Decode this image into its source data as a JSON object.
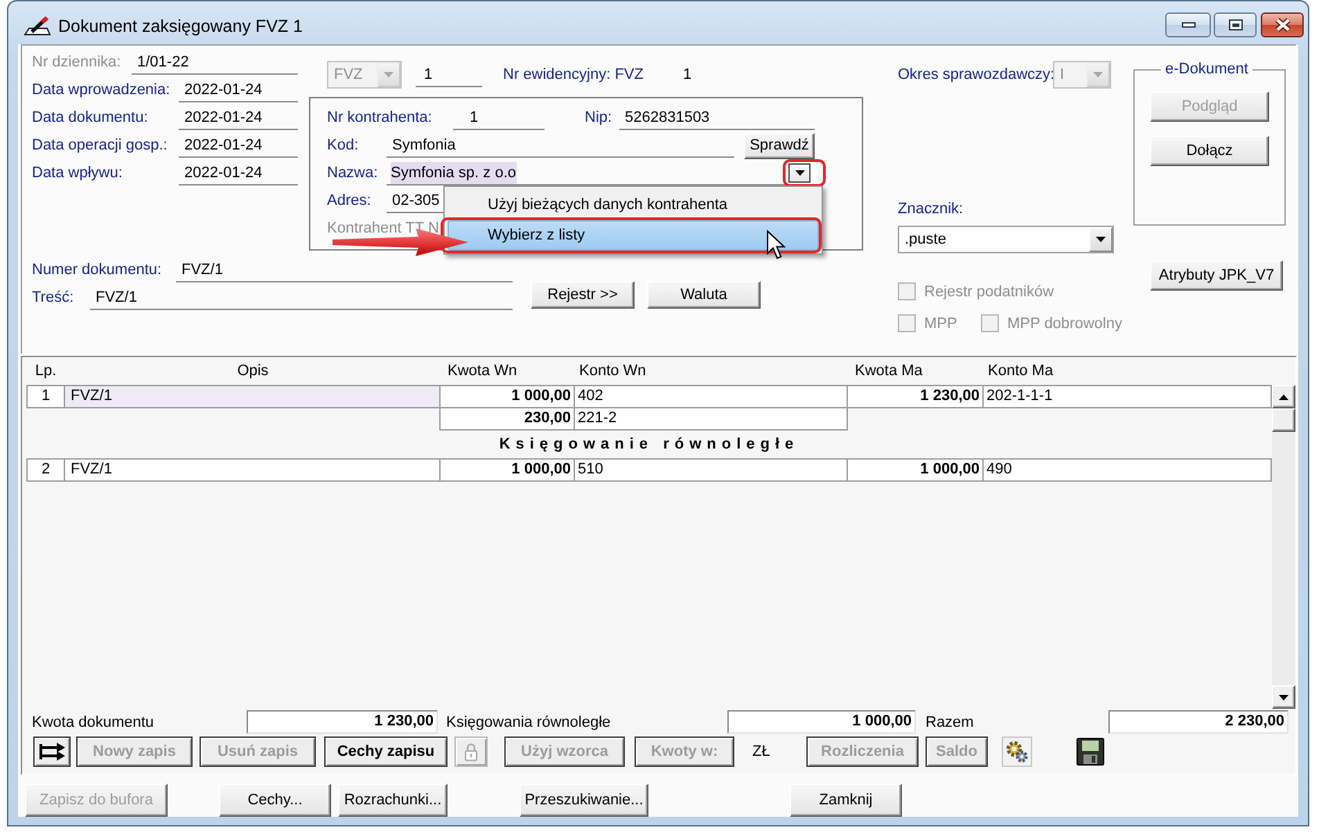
{
  "window": {
    "title": "Dokument zaksięgowany FVZ 1"
  },
  "header": {
    "journal_number": {
      "label": "Nr dziennika:",
      "value": "1/01-22",
      "disabled": true
    },
    "dates": [
      {
        "label": "Data wprowadzenia:",
        "value": "2022-01-24"
      },
      {
        "label": "Data dokumentu:",
        "value": "2022-01-24"
      },
      {
        "label": "Data operacji gosp.:",
        "value": "2022-01-24"
      },
      {
        "label": "Data wpływu:",
        "value": "2022-01-24"
      }
    ],
    "register": {
      "value": "FVZ",
      "disabled": true
    },
    "register_number": "1",
    "record_number": {
      "label": "Nr ewidencyjny: FVZ",
      "value": "1"
    },
    "contractor": {
      "number": {
        "label": "Nr kontrahenta:",
        "value": "1"
      },
      "nip": {
        "label": "Nip:",
        "value": "5262831503"
      },
      "code": {
        "label": "Kod:",
        "value": "Symfonia"
      },
      "check_button": "Sprawdź",
      "name": {
        "label": "Nazwa:",
        "value": "Symfonia sp. z o.o",
        "text_selected": true,
        "dropdown_highlighted": true
      },
      "address": {
        "label": "Adres:",
        "value": "02-305"
      },
      "tt_label": {
        "label": "Kontrahent TT N",
        "disabled": true
      },
      "name_menu": [
        {
          "label": "Użyj bieżących danych kontrahenta",
          "selected": false,
          "highlighted": false
        },
        {
          "label": "Wybierz z listy",
          "selected": true,
          "highlighted": true
        }
      ]
    },
    "document_number": {
      "label": "Numer dokumentu:",
      "value": "FVZ/1"
    },
    "description": {
      "label": "Treść:",
      "value": "FVZ/1"
    },
    "buttons": [
      {
        "label": "Rejestr >>",
        "disabled": false
      },
      {
        "label": "Waluta",
        "disabled": false
      }
    ],
    "reporting_period": {
      "label": "Okres sprawozdawczy:",
      "value": "I",
      "disabled": true
    },
    "marker": {
      "label": "Znacznik:",
      "value": ".puste"
    },
    "e_document": {
      "title": "e-Dokument",
      "buttons": [
        {
          "label": "Podgląd",
          "disabled": true
        },
        {
          "label": "Dołącz",
          "disabled": false
        }
      ]
    },
    "jpk_button": {
      "label": "Atrybuty JPK_V7",
      "disabled": false
    },
    "checkboxes": [
      {
        "label": "Rejestr podatników",
        "checked": false,
        "disabled": true
      },
      {
        "label": "MPP",
        "checked": false,
        "disabled": true
      },
      {
        "label": "MPP dobrowolny",
        "checked": false,
        "disabled": true
      }
    ]
  },
  "table": {
    "columns": [
      "Lp.",
      "Opis",
      "Kwota Wn",
      "Konto Wn",
      "Kwota Ma",
      "Konto Ma"
    ],
    "sections": [
      {
        "entries": [
          {
            "lp": "1",
            "opis": "FVZ/1",
            "selected": true,
            "lines": [
              {
                "kwota_wn": "1 000,00",
                "konto_wn": "402",
                "kwota_ma": "1 230,00",
                "konto_ma": "202-1-1-1"
              },
              {
                "kwota_wn": "230,00",
                "konto_wn": "221-2"
              }
            ]
          }
        ]
      },
      {
        "title": "Księgowanie równoległe",
        "entries": [
          {
            "lp": "2",
            "opis": "FVZ/1",
            "selected": false,
            "lines": [
              {
                "kwota_wn": "1 000,00",
                "konto_wn": "510",
                "kwota_ma": "1 000,00",
                "konto_ma": "490"
              }
            ]
          }
        ]
      }
    ]
  },
  "totals": [
    {
      "label": "Kwota dokumentu",
      "value": "1 230,00"
    },
    {
      "label": "Księgowania równoległe",
      "value": "1 000,00"
    },
    {
      "label": "Razem",
      "value": "2 230,00"
    }
  ],
  "toolbar": [
    {
      "kind": "swap",
      "disabled": false
    },
    {
      "kind": "button",
      "label": "Nowy zapis",
      "disabled": true
    },
    {
      "kind": "button",
      "label": "Usuń zapis",
      "disabled": true
    },
    {
      "kind": "button",
      "label": "Cechy zapisu",
      "disabled": false
    },
    {
      "kind": "lock",
      "disabled": true
    },
    {
      "kind": "button",
      "label": "Użyj wzorca",
      "disabled": true
    },
    {
      "kind": "button",
      "label": "Kwoty w:",
      "disabled": true
    },
    {
      "kind": "text",
      "label": "ZŁ"
    },
    {
      "kind": "button",
      "label": "Rozliczenia",
      "disabled": true
    },
    {
      "kind": "button",
      "label": "Saldo",
      "disabled": true
    },
    {
      "kind": "gears",
      "disabled": false
    },
    {
      "kind": "save",
      "disabled": false
    }
  ],
  "footer_buttons": [
    {
      "label": "Zapisz do bufora",
      "disabled": true
    },
    {
      "label": "Cechy...",
      "disabled": false
    },
    {
      "label": "Rozrachunki...",
      "disabled": false
    },
    {
      "label": "Przeszukiwanie...",
      "disabled": false
    },
    {
      "label": "Zamknij",
      "disabled": false
    }
  ]
}
